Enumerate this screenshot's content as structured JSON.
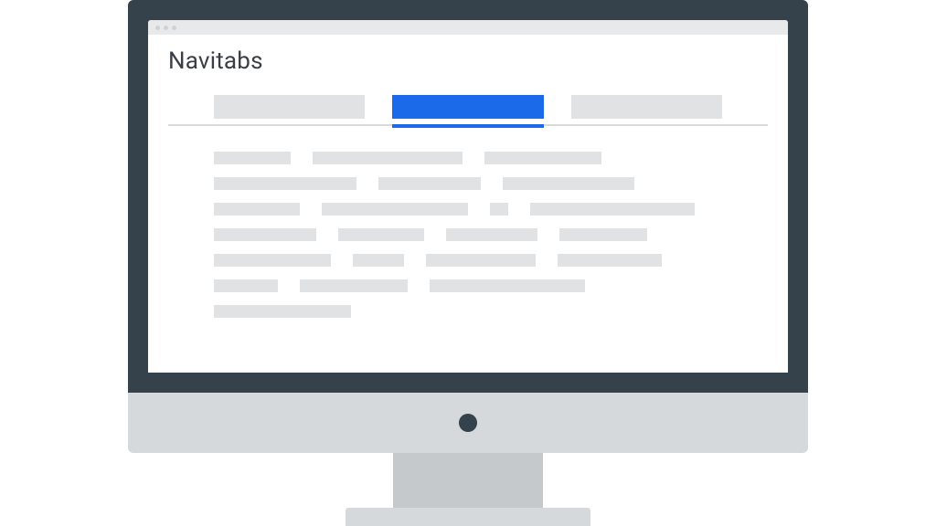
{
  "page": {
    "title": "Navitabs"
  },
  "tabs": {
    "items": [
      {
        "active": false
      },
      {
        "active": true
      },
      {
        "active": false
      }
    ]
  },
  "content": {
    "placeholder_widths": [
      84,
      164,
      128,
      156,
      112,
      144,
      94,
      160,
      20,
      180,
      112,
      94,
      100,
      96,
      128,
      56,
      120,
      114,
      70,
      118,
      170,
      150
    ]
  },
  "colors": {
    "monitor_frame": "#35414b",
    "monitor_chin": "#d6d9db",
    "stand_neck": "#c6c9cb",
    "accent": "#1a6aea",
    "placeholder": "#e1e2e3"
  }
}
